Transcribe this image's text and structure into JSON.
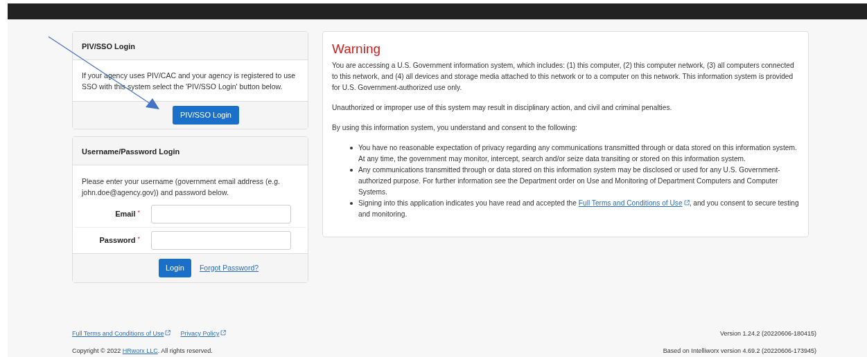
{
  "piv_card": {
    "title": "PIV/SSO Login",
    "text": "If your agency uses PIV/CAC and your agency is registered to use SSO with this system select the 'PIV/SSO Login' button below.",
    "button": "PIV/SSO Login"
  },
  "login_card": {
    "title": "Username/Password Login",
    "text": "Please enter your username (government email address (e.g. john.doe@agency.gov)) and password below.",
    "fields": [
      {
        "label": "Email",
        "mark": "*"
      },
      {
        "label": "Password",
        "mark": "*"
      }
    ],
    "button": "Login",
    "link": "Forgot Password?"
  },
  "warning": {
    "title": "Warning",
    "paragraphs": [
      "You are accessing a U.S. Government information system, which includes: (1) this computer, (2) this computer network, (3) all computers connected to this network, and (4) all devices and storage media attached to this network or to a computer on this network. This information system is provided for U.S. Government-authorized use only.",
      "Unauthorized or improper use of this system may result in disciplinary action, and civil and criminal penalties.",
      "By using this information system, you understand and consent to the following:"
    ],
    "bullets": [
      {
        "text": "You have no reasonable expectation of privacy regarding any communications transmitted through or data stored on this information system. At any time, the government may monitor, intercept, search and/or seize data transiting or stored on this information system."
      },
      {
        "text": "Any communications transmitted through or data stored on this information system may be disclosed or used for any U.S. Government-authorized purpose. For further information see the Department order on Use and Monitoring of Department Computers and Computer Systems."
      },
      {
        "text": "Signing into this application indicates you have read and accepted the",
        "link": "Full Terms and Conditions of Use",
        "text_after": ", and you consent to secure testing and monitoring."
      }
    ]
  },
  "footer": {
    "links": [
      "Full Terms and Conditions of Use",
      "Privacy Policy"
    ],
    "copyright_before": "Copyright © 2022",
    "company_link": "HRworx LLC",
    "copyright_after": ". All rights reserved.",
    "version": "Version 1.24.2 (20220606-180415)",
    "based_on": "Based on Intelliworx version 4.69.2 (20220606-173945)"
  }
}
